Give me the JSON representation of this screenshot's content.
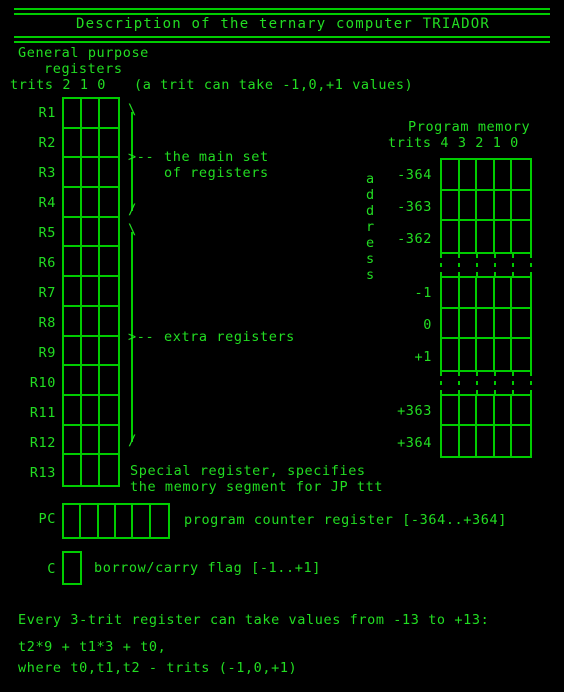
{
  "title": "Description of the ternary computer TRIADOR",
  "header": {
    "general_purpose_line1": "General purpose",
    "general_purpose_line2": "registers",
    "trits_label": "trits 2 1 0",
    "trit_note": "(a trit can take -1,0,+1 values)"
  },
  "registers": {
    "rows": [
      {
        "label": "R1"
      },
      {
        "label": "R2"
      },
      {
        "label": "R3"
      },
      {
        "label": "R4"
      },
      {
        "label": "R5"
      },
      {
        "label": "R6"
      },
      {
        "label": "R7"
      },
      {
        "label": "R8"
      },
      {
        "label": "R9"
      },
      {
        "label": "R10"
      },
      {
        "label": "R11"
      },
      {
        "label": "R12"
      },
      {
        "label": "R13"
      }
    ],
    "trit_count": 3,
    "main_set_note_line1": "the main set",
    "main_set_note_line2": "of registers",
    "extra_note": "extra registers",
    "arrow": ">--",
    "special_note_line1": "Special register, specifies",
    "special_note_line2": "the memory segment for JP ttt"
  },
  "program_memory": {
    "title": "Program memory",
    "trits_header": "trits 4 3 2 1 0",
    "address_label": "address",
    "address_label_letters": [
      "a",
      "d",
      "d",
      "r",
      "e",
      "s",
      "s"
    ],
    "trit_count": 5,
    "address_rows_top": [
      "-364",
      "-363",
      "-362"
    ],
    "address_rows_mid": [
      "-1",
      "0",
      "+1"
    ],
    "address_rows_bottom": [
      "+363",
      "+364"
    ]
  },
  "pc": {
    "label": "PC",
    "trit_count": 6,
    "description": "program counter register [-364..+364]"
  },
  "carry": {
    "label": "C",
    "trit_count": 1,
    "description": "borrow/carry flag [-1..+1]"
  },
  "footer": {
    "line1": "Every 3-trit register can take values from -13 to +13:",
    "line2": "t2*9 + t1*3 + t0,",
    "line3": "where t0,t1,t2 - trits (-1,0,+1)"
  },
  "colors": {
    "background": "#000000",
    "foreground": "#22dd22",
    "line": "#00cc00"
  }
}
